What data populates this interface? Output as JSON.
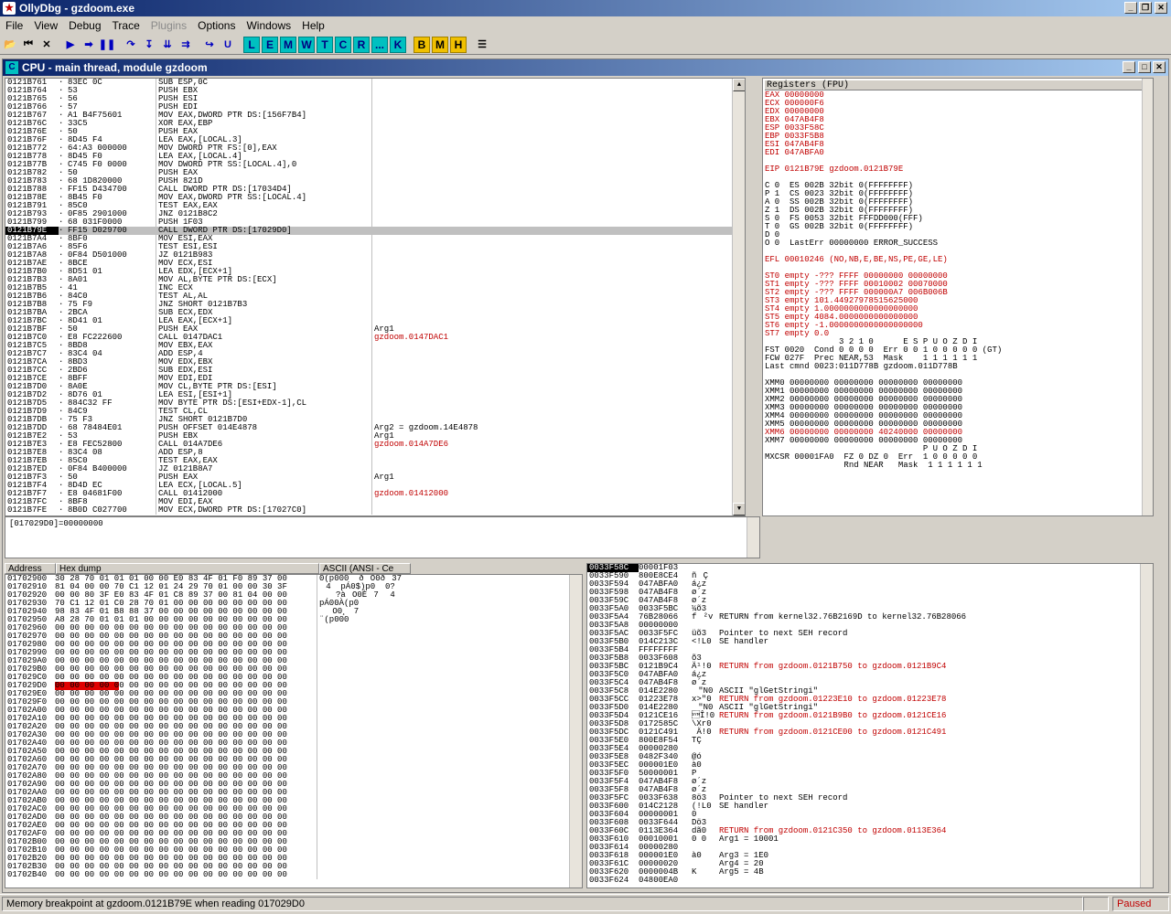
{
  "app": {
    "title": "OllyDbg - gzdoom.exe"
  },
  "menu": [
    "File",
    "View",
    "Debug",
    "Trace",
    "Plugins",
    "Options",
    "Windows",
    "Help"
  ],
  "toolbar_letters": [
    "L",
    "E",
    "M",
    "W",
    "T",
    "C",
    "R",
    "...",
    "K",
    "B",
    "M",
    "H"
  ],
  "cpu": {
    "title": "CPU - main thread, module gzdoom"
  },
  "disasm": [
    [
      "0121B761",
      "83EC 0C",
      "SUB ESP,0C",
      ""
    ],
    [
      "0121B764",
      "53",
      "PUSH EBX",
      ""
    ],
    [
      "0121B765",
      "56",
      "PUSH ESI",
      ""
    ],
    [
      "0121B766",
      "57",
      "PUSH EDI",
      ""
    ],
    [
      "0121B767",
      "A1 B4F75601",
      "MOV EAX,DWORD PTR DS:[156F7B4]",
      ""
    ],
    [
      "0121B76C",
      "33C5",
      "XOR EAX,EBP",
      ""
    ],
    [
      "0121B76E",
      "50",
      "PUSH EAX",
      ""
    ],
    [
      "0121B76F",
      "8D45 F4",
      "LEA EAX,[LOCAL.3]",
      ""
    ],
    [
      "0121B772",
      "64:A3 000000",
      "MOV DWORD PTR FS:[0],EAX",
      ""
    ],
    [
      "0121B778",
      "8D45 F0",
      "LEA EAX,[LOCAL.4]",
      ""
    ],
    [
      "0121B77B",
      "C745 F0 0000",
      "MOV DWORD PTR SS:[LOCAL.4],0",
      ""
    ],
    [
      "0121B782",
      "50",
      "PUSH EAX",
      ""
    ],
    [
      "0121B783",
      "68 1D820000",
      "PUSH 821D",
      ""
    ],
    [
      "0121B788",
      "FF15 D434700",
      "CALL DWORD PTR DS:[17034D4]",
      ""
    ],
    [
      "0121B78E",
      "8B45 F0",
      "MOV EAX,DWORD PTR SS:[LOCAL.4]",
      ""
    ],
    [
      "0121B791",
      "85C0",
      "TEST EAX,EAX",
      ""
    ],
    [
      "0121B793",
      "0F85 2901000",
      "JNZ 0121B8C2",
      ""
    ],
    [
      "0121B799",
      "68 031F0000",
      "PUSH 1F03",
      ""
    ],
    [
      "0121B79E",
      "FF15 D029700",
      "CALL DWORD PTR DS:[17029D0]",
      ""
    ],
    [
      "0121B7A4",
      "8BF0",
      "MOV ESI,EAX",
      ""
    ],
    [
      "0121B7A6",
      "85F6",
      "TEST ESI,ESI",
      ""
    ],
    [
      "0121B7A8",
      "0F84 D501000",
      "JZ 0121B983",
      ""
    ],
    [
      "0121B7AE",
      "8BCE",
      "MOV ECX,ESI",
      ""
    ],
    [
      "0121B7B0",
      "8D51 01",
      "LEA EDX,[ECX+1]",
      ""
    ],
    [
      "0121B7B3",
      "8A01",
      "MOV AL,BYTE PTR DS:[ECX]",
      ""
    ],
    [
      "0121B7B5",
      "41",
      "INC ECX",
      ""
    ],
    [
      "0121B7B6",
      "84C0",
      "TEST AL,AL",
      ""
    ],
    [
      "0121B7B8",
      "75 F9",
      "JNZ SHORT 0121B7B3",
      ""
    ],
    [
      "0121B7BA",
      "2BCA",
      "SUB ECX,EDX",
      ""
    ],
    [
      "0121B7BC",
      "8D41 01",
      "LEA EAX,[ECX+1]",
      ""
    ],
    [
      "0121B7BF",
      "50",
      "PUSH EAX",
      "Arg1"
    ],
    [
      "0121B7C0",
      "E8 FC222600",
      "CALL 0147DAC1",
      "gzdoom.0147DAC1"
    ],
    [
      "0121B7C5",
      "8BD8",
      "MOV EBX,EAX",
      ""
    ],
    [
      "0121B7C7",
      "83C4 04",
      "ADD ESP,4",
      ""
    ],
    [
      "0121B7CA",
      "8BD3",
      "MOV EDX,EBX",
      ""
    ],
    [
      "0121B7CC",
      "2BD6",
      "SUB EDX,ESI",
      ""
    ],
    [
      "0121B7CE",
      "8BFF",
      "MOV EDI,EDI",
      ""
    ],
    [
      "0121B7D0",
      "8A0E",
      "MOV CL,BYTE PTR DS:[ESI]",
      ""
    ],
    [
      "0121B7D2",
      "8D76 01",
      "LEA ESI,[ESI+1]",
      ""
    ],
    [
      "0121B7D5",
      "884C32 FF",
      "MOV BYTE PTR DS:[ESI+EDX-1],CL",
      ""
    ],
    [
      "0121B7D9",
      "84C9",
      "TEST CL,CL",
      ""
    ],
    [
      "0121B7DB",
      "75 F3",
      "JNZ SHORT 0121B7D0",
      ""
    ],
    [
      "0121B7DD",
      "68 78484E01",
      "PUSH OFFSET 014E4878",
      "Arg2 = gzdoom.14E4878"
    ],
    [
      "0121B7E2",
      "53",
      "PUSH EBX",
      "Arg1"
    ],
    [
      "0121B7E3",
      "E8 FEC52800",
      "CALL 014A7DE6",
      "gzdoom.014A7DE6"
    ],
    [
      "0121B7E8",
      "83C4 08",
      "ADD ESP,8",
      ""
    ],
    [
      "0121B7EB",
      "85C0",
      "TEST EAX,EAX",
      ""
    ],
    [
      "0121B7ED",
      "0F84 B400000",
      "JZ 0121B8A7",
      ""
    ],
    [
      "0121B7F3",
      "50",
      "PUSH EAX",
      "Arg1"
    ],
    [
      "0121B7F4",
      "8D4D EC",
      "LEA ECX,[LOCAL.5]",
      ""
    ],
    [
      "0121B7F7",
      "E8 04681F00",
      "CALL 01412000",
      "gzdoom.01412000"
    ],
    [
      "0121B7FC",
      "8BF8",
      "MOV EDI,EAX",
      ""
    ],
    [
      "0121B7FE",
      "8B0D C027700",
      "MOV ECX,DWORD PTR DS:[17027C0]",
      ""
    ]
  ],
  "info_line": "[017029D0]=00000000",
  "registers": {
    "header": "Registers (FPU)",
    "lines": [
      "EAX 00000000",
      "ECX 000000F6",
      "EDX 00000000",
      "EBX 047AB4F8",
      "ESP 0033F58C",
      "EBP 0033F5B8",
      "ESI 047AB4F8",
      "EDI 047ABFA0",
      "",
      "EIP 0121B79E gzdoom.0121B79E",
      "",
      "C 0  ES 002B 32bit 0(FFFFFFFF)",
      "P 1  CS 0023 32bit 0(FFFFFFFF)",
      "A 0  SS 002B 32bit 0(FFFFFFFF)",
      "Z 1  DS 002B 32bit 0(FFFFFFFF)",
      "S 0  FS 0053 32bit FFFDD000(FFF)",
      "T 0  GS 002B 32bit 0(FFFFFFFF)",
      "D 0",
      "O 0  LastErr 00000000 ERROR_SUCCESS",
      "",
      "EFL 00010246 (NO,NB,E,BE,NS,PE,GE,LE)",
      "",
      "ST0 empty -??? FFFF 00000000 00000000",
      "ST1 empty -??? FFFF 00010002 00070000",
      "ST2 empty -??? FFFF 000000A7 006B006B",
      "ST3 empty 101.44927978515625000",
      "ST4 empty 1.0000000000000000000",
      "ST5 empty 4084.0000000000000000",
      "ST6 empty -1.0000000000000000000",
      "ST7 empty 0.0",
      "               3 2 1 0      E S P U O Z D I",
      "FST 0020  Cond 0 0 0 0  Err 0 0 1 0 0 0 0 0 (GT)",
      "FCW 027F  Prec NEAR,53  Mask    1 1 1 1 1 1",
      "Last cmnd 0023:011D778B gzdoom.011D778B",
      "",
      "XMM0 00000000 00000000 00000000 00000000",
      "XMM1 00000000 00000000 00000000 00000000",
      "XMM2 00000000 00000000 00000000 00000000",
      "XMM3 00000000 00000000 00000000 00000000",
      "XMM4 00000000 00000000 00000000 00000000",
      "XMM5 00000000 00000000 00000000 00000000",
      "XMM6 00000000 00000000 40240000 00000000",
      "XMM7 00000000 00000000 00000000 00000000",
      "                                P U O Z D I",
      "MXCSR 00001FA0  FZ 0 DZ 0  Err  1 0 0 0 0 0",
      "                Rnd NEAR   Mask  1 1 1 1 1 1"
    ]
  },
  "hex": {
    "headers": [
      "Address",
      "Hex dump",
      "ASCII (ANSI - Ce"
    ],
    "rows": [
      [
        "01702900",
        "30 28 70 01 01 01 00 00 E0 83 4F 01 F0 89 37 00",
        "0(p000  ðO0ð37"
      ],
      [
        "01702910",
        "81 04 00 00 70 C1 12 01 24 29 70 01 00 00 30 3F",
        "4  pÁ0$)p0  0?"
      ],
      [
        "01702920",
        "00 00 80 3F E0 83 4F 01 C8 89 37 00 81 04 00 00",
        "  ?àO0È7 4"
      ],
      [
        "01702930",
        "70 C1 12 01 C0 28 70 01 00 00 00 00 00 00 00 00",
        "pÁ00À(p0"
      ],
      [
        "01702940",
        "98 83 4F 01 B8 88 37 00 00 00 00 00 00 00 00 00",
        "O0¸7"
      ],
      [
        "01702950",
        "A8 28 70 01 01 01 00 00 00 00 00 00 00 00 00 00",
        "¨(p000"
      ],
      [
        "01702960",
        "00 00 00 00 00 00 00 00 00 00 00 00 00 00 00 00",
        ""
      ],
      [
        "01702970",
        "00 00 00 00 00 00 00 00 00 00 00 00 00 00 00 00",
        ""
      ],
      [
        "01702980",
        "00 00 00 00 00 00 00 00 00 00 00 00 00 00 00 00",
        ""
      ],
      [
        "01702990",
        "00 00 00 00 00 00 00 00 00 00 00 00 00 00 00 00",
        ""
      ],
      [
        "017029A0",
        "00 00 00 00 00 00 00 00 00 00 00 00 00 00 00 00",
        ""
      ],
      [
        "017029B0",
        "00 00 00 00 00 00 00 00 00 00 00 00 00 00 00 00",
        ""
      ],
      [
        "017029C0",
        "00 00 00 00 00 00 00 00 00 00 00 00 00 00 00 00",
        ""
      ],
      [
        "017029D0",
        "00 00 00 00 00 00 00 00 00 00 00 00 00 00 00 00",
        ""
      ],
      [
        "017029E0",
        "00 00 00 00 00 00 00 00 00 00 00 00 00 00 00 00",
        ""
      ],
      [
        "017029F0",
        "00 00 00 00 00 00 00 00 00 00 00 00 00 00 00 00",
        ""
      ],
      [
        "01702A00",
        "00 00 00 00 00 00 00 00 00 00 00 00 00 00 00 00",
        ""
      ],
      [
        "01702A10",
        "00 00 00 00 00 00 00 00 00 00 00 00 00 00 00 00",
        ""
      ],
      [
        "01702A20",
        "00 00 00 00 00 00 00 00 00 00 00 00 00 00 00 00",
        ""
      ],
      [
        "01702A30",
        "00 00 00 00 00 00 00 00 00 00 00 00 00 00 00 00",
        ""
      ],
      [
        "01702A40",
        "00 00 00 00 00 00 00 00 00 00 00 00 00 00 00 00",
        ""
      ],
      [
        "01702A50",
        "00 00 00 00 00 00 00 00 00 00 00 00 00 00 00 00",
        ""
      ],
      [
        "01702A60",
        "00 00 00 00 00 00 00 00 00 00 00 00 00 00 00 00",
        ""
      ],
      [
        "01702A70",
        "00 00 00 00 00 00 00 00 00 00 00 00 00 00 00 00",
        ""
      ],
      [
        "01702A80",
        "00 00 00 00 00 00 00 00 00 00 00 00 00 00 00 00",
        ""
      ],
      [
        "01702A90",
        "00 00 00 00 00 00 00 00 00 00 00 00 00 00 00 00",
        ""
      ],
      [
        "01702AA0",
        "00 00 00 00 00 00 00 00 00 00 00 00 00 00 00 00",
        ""
      ],
      [
        "01702AB0",
        "00 00 00 00 00 00 00 00 00 00 00 00 00 00 00 00",
        ""
      ],
      [
        "01702AC0",
        "00 00 00 00 00 00 00 00 00 00 00 00 00 00 00 00",
        ""
      ],
      [
        "01702AD0",
        "00 00 00 00 00 00 00 00 00 00 00 00 00 00 00 00",
        ""
      ],
      [
        "01702AE0",
        "00 00 00 00 00 00 00 00 00 00 00 00 00 00 00 00",
        ""
      ],
      [
        "01702AF0",
        "00 00 00 00 00 00 00 00 00 00 00 00 00 00 00 00",
        ""
      ],
      [
        "01702B00",
        "00 00 00 00 00 00 00 00 00 00 00 00 00 00 00 00",
        ""
      ],
      [
        "01702B10",
        "00 00 00 00 00 00 00 00 00 00 00 00 00 00 00 00",
        ""
      ],
      [
        "01702B20",
        "00 00 00 00 00 00 00 00 00 00 00 00 00 00 00 00",
        ""
      ],
      [
        "01702B30",
        "00 00 00 00 00 00 00 00 00 00 00 00 00 00 00 00",
        ""
      ],
      [
        "01702B40",
        "00 00 00 00 00 00 00 00 00 00 00 00 00 00 00 00",
        ""
      ]
    ]
  },
  "stack": {
    "headers": [
      "0033F58C",
      "00001F03"
    ],
    "rows": [
      [
        "0033F590",
        "800E8CE4",
        "ñÇ",
        ""
      ],
      [
        "0033F594",
        "047ABFA0",
        "á¿z",
        ""
      ],
      [
        "0033F598",
        "047AB4F8",
        "ø´z",
        ""
      ],
      [
        "0033F59C",
        "047AB4F8",
        "ø´z",
        ""
      ],
      [
        "0033F5A0",
        "0033F5BC",
        "¼õ3",
        ""
      ],
      [
        "0033F5A4",
        "76B28066",
        "f²v",
        "RETURN from kernel32.76B2169D to kernel32.76B28066"
      ],
      [
        "0033F5A8",
        "00000000",
        "",
        ""
      ],
      [
        "0033F5AC",
        "0033F5FC",
        "üõ3",
        "Pointer to next SEH record"
      ],
      [
        "0033F5B0",
        "014C213C",
        "<!L0",
        "SE handler"
      ],
      [
        "0033F5B4",
        "FFFFFFFF",
        "",
        ""
      ],
      [
        "0033F5B8",
        "0033F608",
        "õ3",
        ""
      ],
      [
        "0033F5BC",
        "0121B9C4",
        "Ä¹!0",
        "RETURN from gzdoom.0121B750 to gzdoom.0121B9C4"
      ],
      [
        "0033F5C0",
        "047ABFA0",
        "á¿z",
        ""
      ],
      [
        "0033F5C4",
        "047AB4F8",
        "ø´z",
        ""
      ],
      [
        "0033F5C8",
        "014E2280",
        "\"N0",
        "ASCII \"glGetStringi\""
      ],
      [
        "0033F5CC",
        "01223E78",
        "x>\"0",
        "RETURN from gzdoom.01223E10 to gzdoom.01223E78"
      ],
      [
        "0033F5D0",
        "014E2280",
        "\"N0",
        "ASCII \"glGetStringi\""
      ],
      [
        "0033F5D4",
        "0121CE16",
        "\u0016Î!0",
        "RETURN from gzdoom.0121B9B0 to gzdoom.0121CE16"
      ],
      [
        "0033F5D8",
        "0172585C",
        "\\Xr0",
        ""
      ],
      [
        "0033F5DC",
        "0121C491",
        "Ä!0",
        "RETURN from gzdoom.0121CE00 to gzdoom.0121C491"
      ],
      [
        "0033F5E0",
        "800E8F54",
        "TÇ",
        ""
      ],
      [
        "0033F5E4",
        "00000280",
        "",
        ""
      ],
      [
        "0033F5E8",
        "0482F340",
        "@ó",
        ""
      ],
      [
        "0033F5EC",
        "000001E0",
        "à0",
        ""
      ],
      [
        "0033F5F0",
        "50000001",
        "P",
        ""
      ],
      [
        "0033F5F4",
        "047AB4F8",
        "ø´z",
        ""
      ],
      [
        "0033F5F8",
        "047AB4F8",
        "ø´z",
        ""
      ],
      [
        "0033F5FC",
        "0033F638",
        "8ö3",
        "Pointer to next SEH record"
      ],
      [
        "0033F600",
        "014C2128",
        "(!L0",
        "SE handler"
      ],
      [
        "0033F604",
        "00000001",
        "0",
        ""
      ],
      [
        "0033F608",
        "0033F644",
        "Dö3",
        ""
      ],
      [
        "0033F60C",
        "0113E364",
        "dã0",
        "RETURN from gzdoom.0121C350 to gzdoom.0113E364"
      ],
      [
        "0033F610",
        "00010001",
        "0 0",
        "Arg1 = 10001"
      ],
      [
        "0033F614",
        "00000280",
        "",
        ""
      ],
      [
        "0033F618",
        "000001E0",
        "à0",
        "Arg3 = 1E0"
      ],
      [
        "0033F61C",
        "00000020",
        "",
        "Arg4 = 20"
      ],
      [
        "0033F620",
        "0000004B",
        "K",
        "Arg5 = 4B"
      ],
      [
        "0033F624",
        "04800EA0",
        "",
        ""
      ]
    ]
  },
  "status": {
    "message": "Memory breakpoint at gzdoom.0121B79E when reading 017029D0",
    "state": "Paused"
  }
}
